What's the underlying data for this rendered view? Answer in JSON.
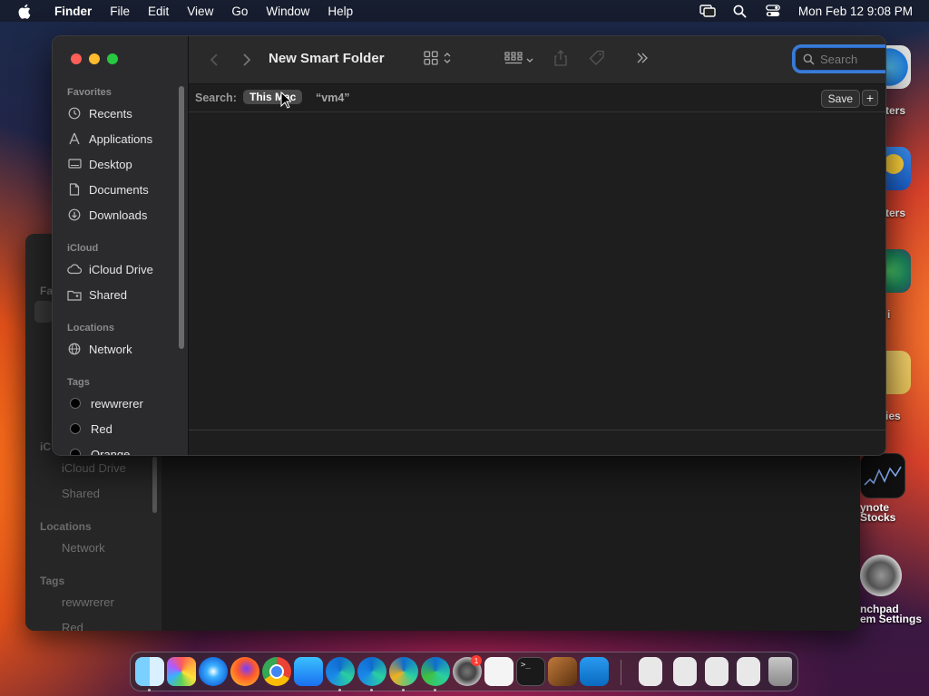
{
  "menubar": {
    "items": [
      "Finder",
      "File",
      "Edit",
      "View",
      "Go",
      "Window",
      "Help"
    ],
    "clock": "Mon Feb 12  9:08 PM"
  },
  "desktop_labels": [
    "ters",
    "ters",
    "i",
    "ies",
    "ynote",
    "Stocks",
    "nchpad",
    "em Settings"
  ],
  "back_window": {
    "sidebar": {
      "sections": [
        "Favo",
        "iC",
        "Locations",
        "Tags"
      ],
      "items": [
        "iCloud Drive",
        "Shared",
        "Network",
        "rewwrerer",
        "Red"
      ]
    }
  },
  "window": {
    "title": "New Smart Folder",
    "search_placeholder": "Search",
    "scope": {
      "label": "Search:",
      "this_mac": "This Mac",
      "folder": "“vm4”",
      "save": "Save",
      "add": "+"
    },
    "sidebar": {
      "favorites_title": "Favorites",
      "favorites": [
        {
          "label": "Recents",
          "icon": "clock-icon"
        },
        {
          "label": "Applications",
          "icon": "applications-icon"
        },
        {
          "label": "Desktop",
          "icon": "desktop-icon"
        },
        {
          "label": "Documents",
          "icon": "document-icon"
        },
        {
          "label": "Downloads",
          "icon": "download-icon"
        }
      ],
      "icloud_title": "iCloud",
      "icloud": [
        {
          "label": "iCloud Drive",
          "icon": "cloud-icon"
        },
        {
          "label": "Shared",
          "icon": "shared-folder-icon"
        }
      ],
      "locations_title": "Locations",
      "locations": [
        {
          "label": "Network",
          "icon": "globe-icon"
        }
      ],
      "tags_title": "Tags",
      "tags": [
        {
          "label": "rewwrerer"
        },
        {
          "label": "Red"
        },
        {
          "label": "Orange"
        }
      ]
    }
  },
  "dock": {
    "apps": [
      "finder-icon",
      "launchpad-icon",
      "safari-icon",
      "firefox-icon",
      "chrome-icon",
      "app-store-icon",
      "edge-icon",
      "edge-beta-icon",
      "edge-canary-icon",
      "edge-dev-icon",
      "system-settings-icon",
      "textedit-icon",
      "terminal-icon",
      "garageband-icon",
      "vscode-icon"
    ],
    "docs": [
      "document-icon",
      "document-icon",
      "document-icon",
      "document-icon",
      "trash-icon"
    ],
    "badge": "1"
  }
}
